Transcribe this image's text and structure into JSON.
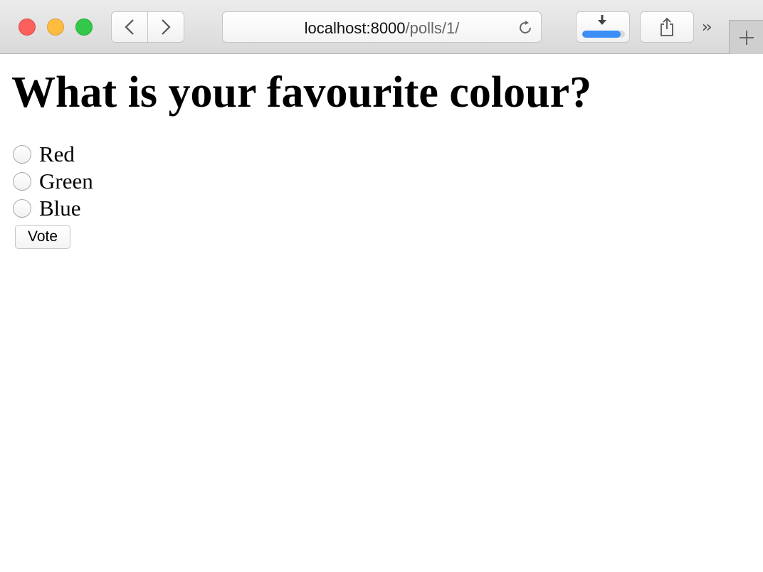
{
  "browser": {
    "url_host": "localhost:8000",
    "url_path": "/polls/1/",
    "download_progress": 0.9,
    "icons": [
      "close-icon",
      "minimize-icon",
      "maximize-icon",
      "back-arrow-icon",
      "forward-arrow-icon",
      "reload-icon",
      "download-icon",
      "share-icon",
      "overflow-chevrons-icon",
      "plus-icon"
    ],
    "accent_color": "#3a8ef6"
  },
  "poll": {
    "question": "What is your favourite colour?",
    "choices": [
      "Red",
      "Green",
      "Blue"
    ],
    "submit_label": "Vote"
  }
}
